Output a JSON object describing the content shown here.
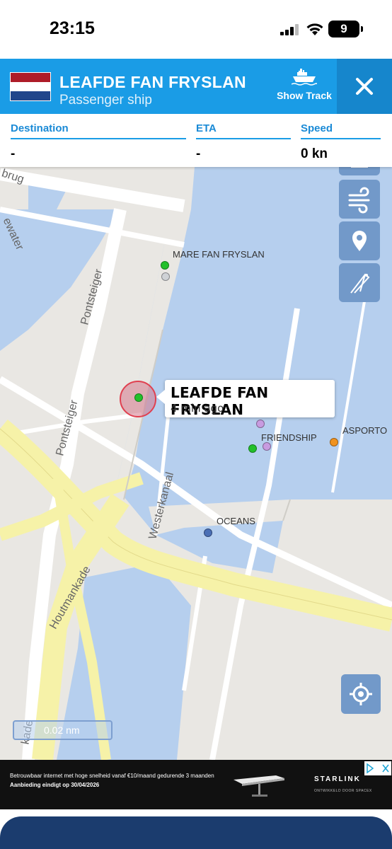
{
  "status_bar": {
    "time": "23:15",
    "battery": "9"
  },
  "vessel": {
    "name": "LEAFDE FAN FRYSLAN",
    "type": "Passenger ship",
    "flag": "Netherlands",
    "flag_colors": [
      "#ae1c28",
      "#ffffff",
      "#21468b"
    ],
    "show_track_label": "Show Track"
  },
  "info": {
    "destination_label": "Destination",
    "destination_value": "-",
    "eta_label": "ETA",
    "eta_value": "-",
    "speed_label": "Speed",
    "speed_value": "0 kn"
  },
  "map": {
    "street_labels": [
      "brug",
      "ewater",
      "Pontsteiger",
      "Pontsteiger",
      "Westerkanaal",
      "Houtmankade",
      "kade"
    ],
    "vessels": [
      {
        "name": "MARE FAN FRYSLAN",
        "color": "#22c02a"
      },
      {
        "name": "FRIENDSHIP",
        "color": "#c89be0"
      },
      {
        "name": "ASPORTO",
        "color": "#f0921f"
      },
      {
        "name": "OCEANS",
        "color": "#4a6fb5"
      }
    ],
    "selected": {
      "name": "LEAFDE FAN FRYSLAN",
      "time_ago": "4 min ago"
    },
    "scale_label": "0.02 nm",
    "colors": {
      "water": "#b6cfee",
      "land": "#e9e7e3",
      "road_major": "#f6f2a8",
      "button": "#7299c9"
    }
  },
  "ad": {
    "line1": "Betrouwbaar internet met hoge snelheid vanaf €10/maand gedurende 3 maanden",
    "line2": "Aanbieding eindigt op 30/04/2026",
    "brand": "STARLINK",
    "sub": "ONTWIKKELD DOOR SPACEX"
  }
}
